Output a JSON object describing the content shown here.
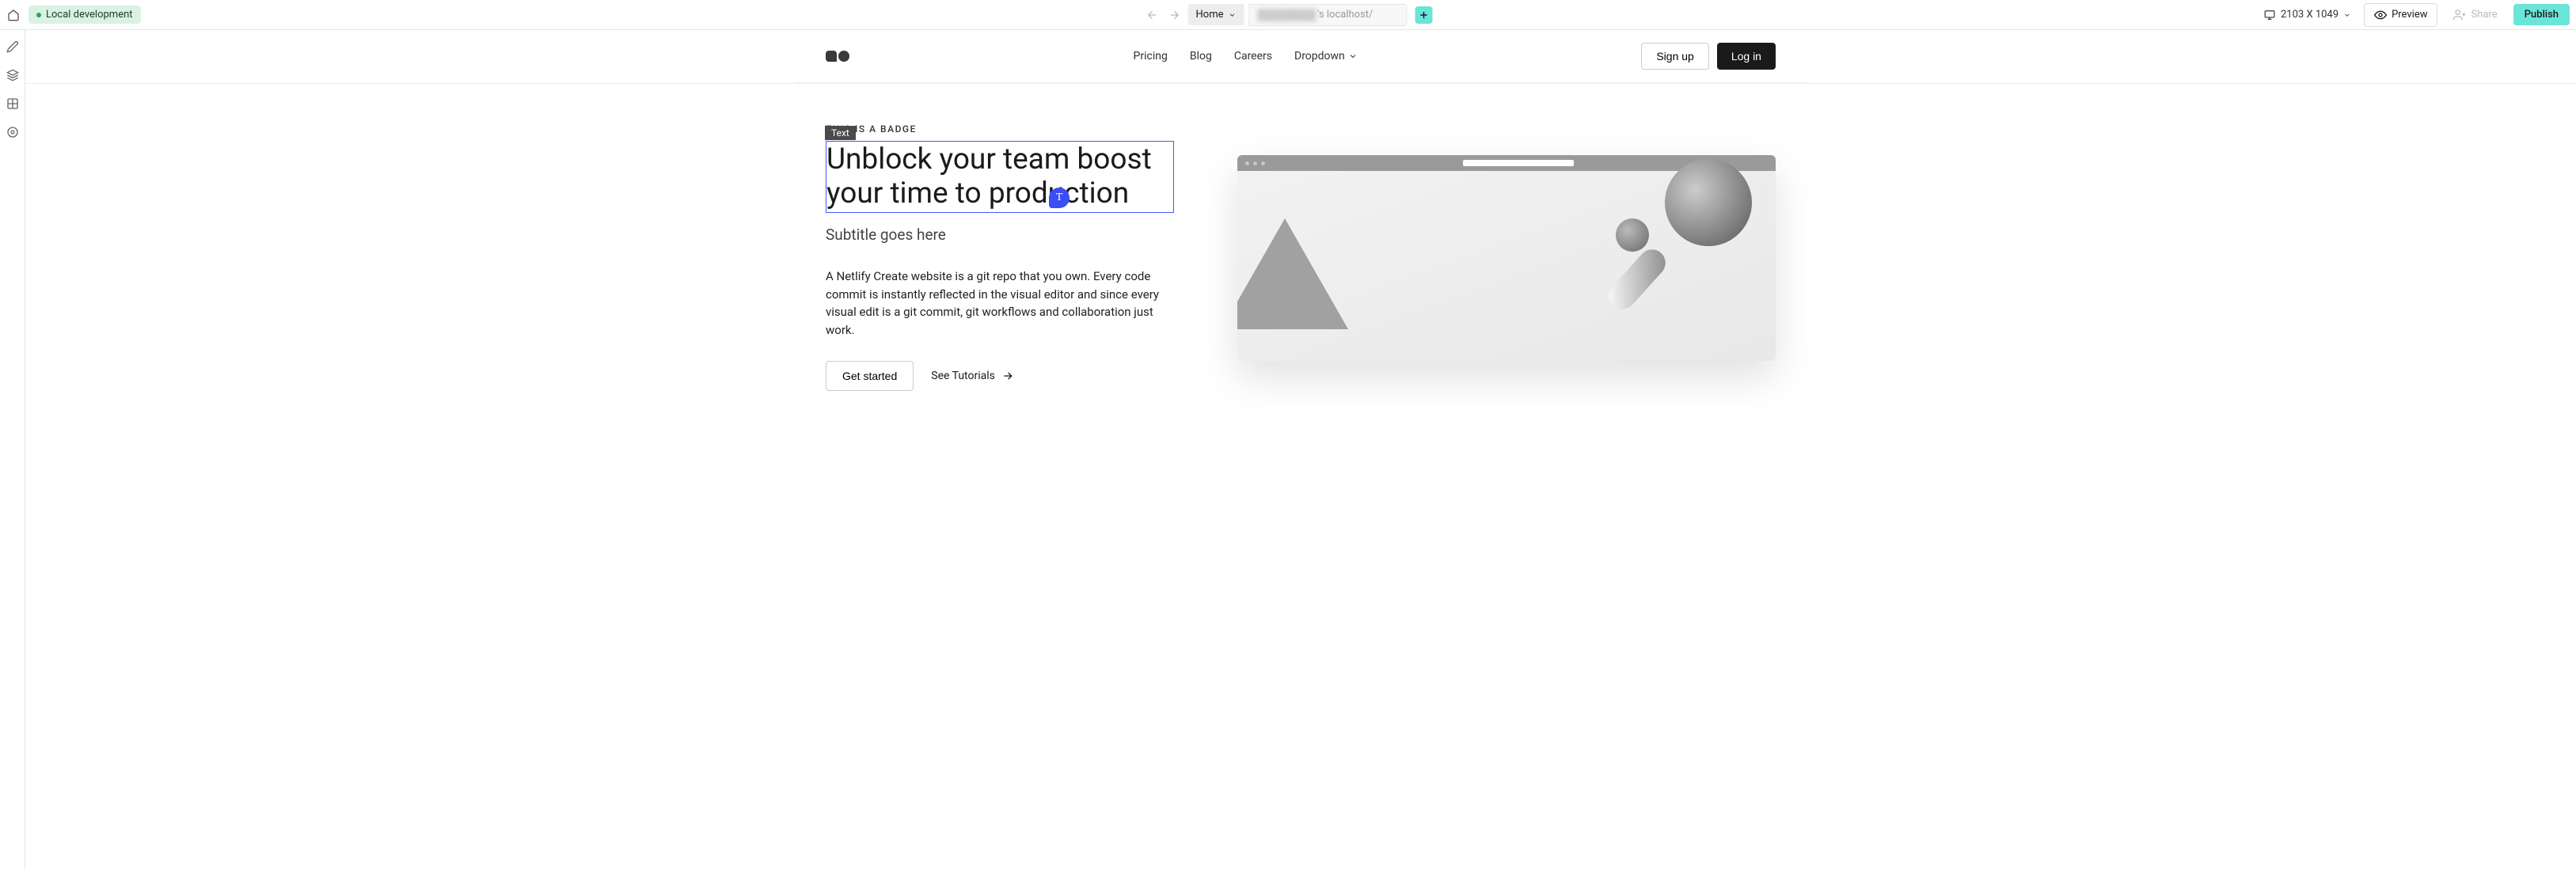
{
  "toolbar": {
    "env_label": "Local development",
    "page_name": "Home",
    "url_suffix": "'s localhost/",
    "viewport_text": "2103 X 1049",
    "preview_label": "Preview",
    "share_label": "Share",
    "publish_label": "Publish"
  },
  "site": {
    "nav": {
      "items": [
        "Pricing",
        "Blog",
        "Careers",
        "Dropdown"
      ]
    },
    "auth": {
      "signup_label": "Sign up",
      "login_label": "Log in"
    }
  },
  "hero": {
    "badge": "THIS IS A BADGE",
    "element_label": "Text",
    "title": "Unblock your team boost your time to production",
    "title_badge_letter": "T",
    "subtitle": "Subtitle goes here",
    "body": "A Netlify Create website is a git repo that you own. Every code commit is instantly reflected in the visual editor and since every visual edit is a git commit, git workflows and collaboration just work.",
    "cta_primary": "Get started",
    "cta_secondary": "See Tutorials"
  }
}
